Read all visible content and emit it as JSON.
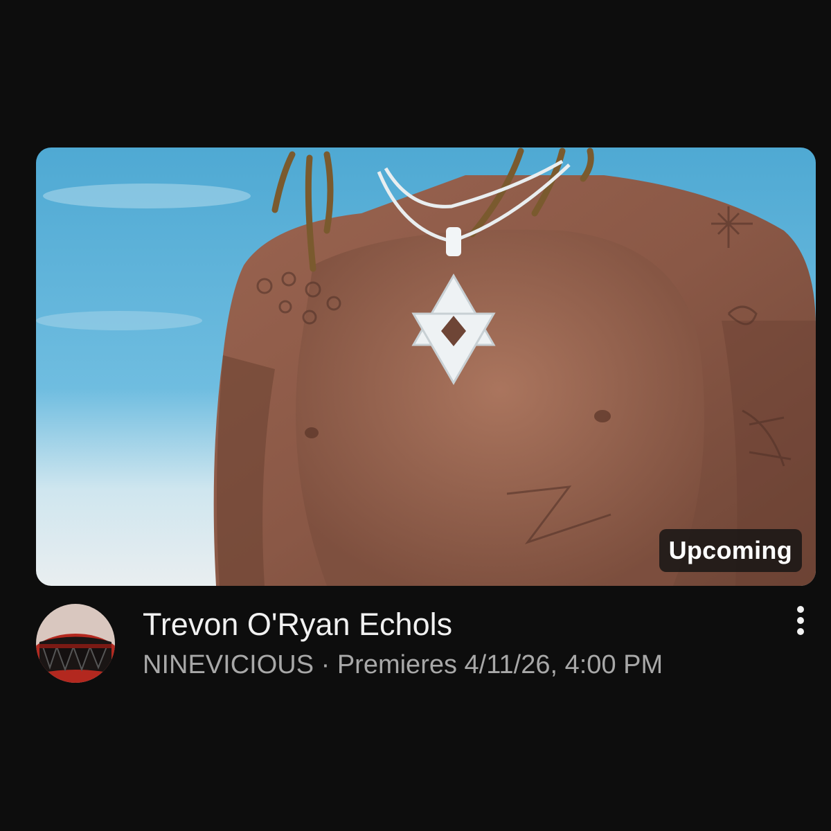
{
  "video": {
    "badge": "Upcoming",
    "title": "Trevon O'Ryan Echols",
    "channel": "NINEVICIOUS",
    "separator": " · ",
    "premiere_text": "Premieres 4/11/26, 4:00 PM"
  },
  "icons": {
    "more": "more-vert-icon",
    "star": "star-of-david-pendant"
  },
  "colors": {
    "background": "#0d0d0d",
    "title": "#f1f1f1",
    "subtext": "#a8a8a8",
    "sky": "#5fb3d8",
    "skin": "#8a5a44"
  }
}
